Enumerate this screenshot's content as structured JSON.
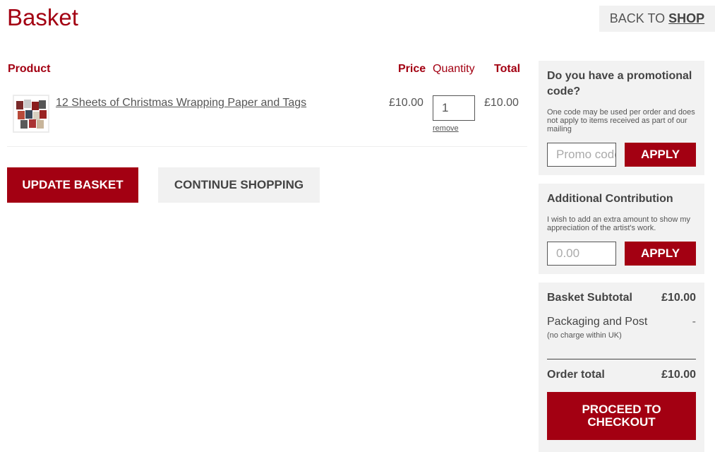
{
  "page": {
    "title": "Basket"
  },
  "nav": {
    "back_prefix": "BACK TO",
    "back_shop": "SHOP"
  },
  "table": {
    "headers": {
      "product": "Product",
      "price": "Price",
      "quantity": "Quantity",
      "total": "Total"
    },
    "items": [
      {
        "name": "12 Sheets of Christmas Wrapping Paper and Tags",
        "price": "£10.00",
        "quantity": "1",
        "remove": "remove",
        "total": "£10.00"
      }
    ]
  },
  "actions": {
    "update": "UPDATE BASKET",
    "continue": "CONTINUE SHOPPING"
  },
  "promo": {
    "title": "Do you have a promotional code?",
    "text": "One code may be used per order and does not apply to items received as part of our mailing",
    "placeholder": "Promo code",
    "apply": "APPLY"
  },
  "contribution": {
    "title": "Additional Contribution",
    "text": "I wish to add an extra amount to show my appreciation of the artist's work.",
    "placeholder": "0.00",
    "apply": "APPLY"
  },
  "summary": {
    "subtotal_label": "Basket Subtotal",
    "subtotal_value": "£10.00",
    "postage_label": "Packaging and Post",
    "postage_value": "-",
    "postage_note": "(no charge within UK)",
    "total_label": "Order total",
    "total_value": "£10.00",
    "checkout": "PROCEED TO CHECKOUT"
  },
  "colors": {
    "brand": "#a30012",
    "panel_bg": "#f2f2f2",
    "secondary_btn": "#f1f1f1"
  }
}
